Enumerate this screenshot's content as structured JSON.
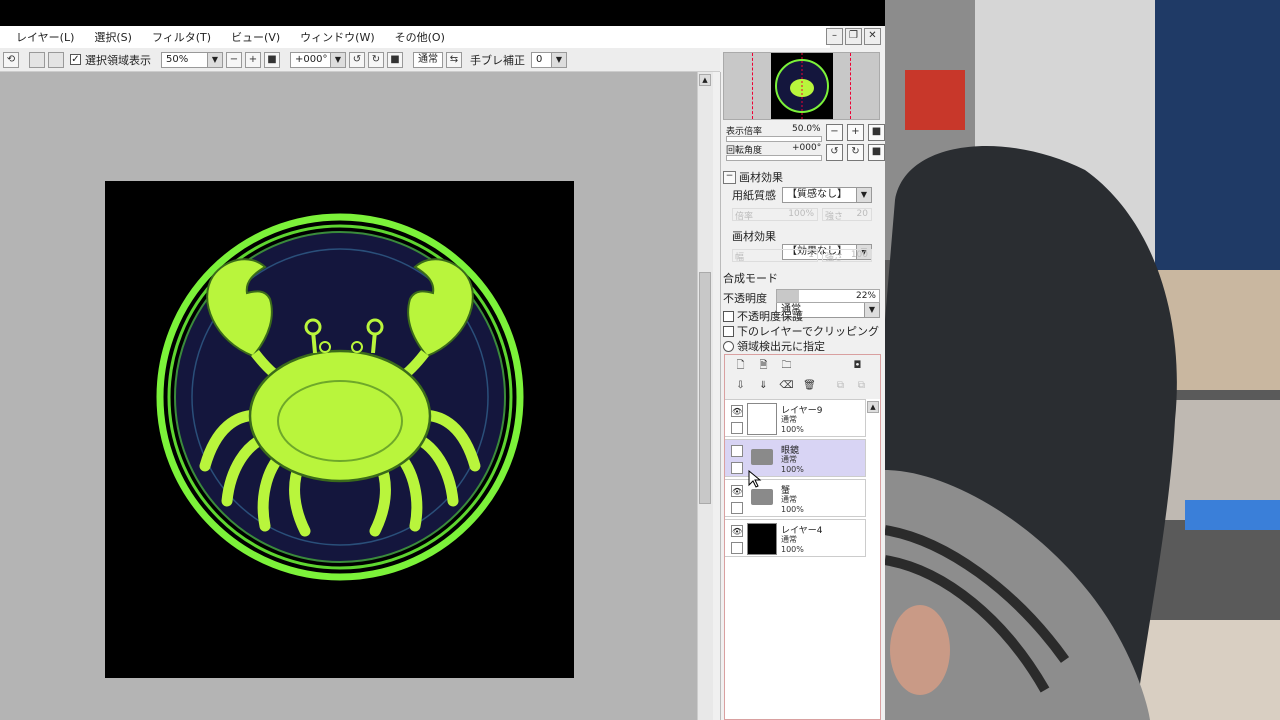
{
  "menu": [
    "レイヤー(L)",
    "選択(S)",
    "フィルタ(T)",
    "ビュー(V)",
    "ウィンドウ(W)",
    "その他(O)"
  ],
  "toolbar": {
    "show_selection_label": "選択領域表示",
    "zoom_value": "50%",
    "rotation_value": "+000°",
    "blend_button": "通常",
    "stabilizer_label": "手ブレ補正",
    "stabilizer_value": "0"
  },
  "navigator": {
    "zoom_label": "表示倍率",
    "zoom_value": "50.0%",
    "rotation_label": "回転角度",
    "rotation_value": "+000°"
  },
  "texture": {
    "header": "画材効果",
    "paper_label": "用紙質感",
    "paper_value": "【質感なし】",
    "paper_strength_label": "倍率",
    "paper_strength_value": "100%",
    "paper_intensity_label": "強さ",
    "paper_intensity_value": "20",
    "effect_label": "画材効果",
    "effect_value": "【効果なし】",
    "effect_width_label": "幅",
    "effect_width_value": "1",
    "effect_intensity_label": "強さ",
    "effect_intensity_value": "100"
  },
  "layer_props": {
    "blend_label": "合成モード",
    "blend_value": "通常",
    "opacity_label": "不透明度",
    "opacity_value": "22%",
    "opacity_fraction": 0.22,
    "preserve_opacity": "不透明度保護",
    "clipping": "下のレイヤーでクリッピング",
    "selection_source": "領域検出元に指定"
  },
  "layers": [
    {
      "name": "レイヤー9",
      "mode": "通常",
      "opacity": "100%",
      "type": "layer",
      "visible": true,
      "thumb": "#ffffff",
      "selected": false
    },
    {
      "name": "眼鏡",
      "mode": "通常",
      "opacity": "100%",
      "type": "folder",
      "visible": false,
      "thumb": "",
      "selected": true
    },
    {
      "name": "蟹",
      "mode": "通常",
      "opacity": "100%",
      "type": "folder",
      "visible": true,
      "thumb": "",
      "selected": false
    },
    {
      "name": "レイヤー4",
      "mode": "通常",
      "opacity": "100%",
      "type": "layer",
      "visible": true,
      "thumb": "#000000",
      "selected": false
    }
  ],
  "colors": {
    "accent_green": "#7cf23a",
    "crab_fill": "#b9f53c",
    "emblem_bg": "#14163d",
    "selected_layer": "#d8d4f4"
  }
}
